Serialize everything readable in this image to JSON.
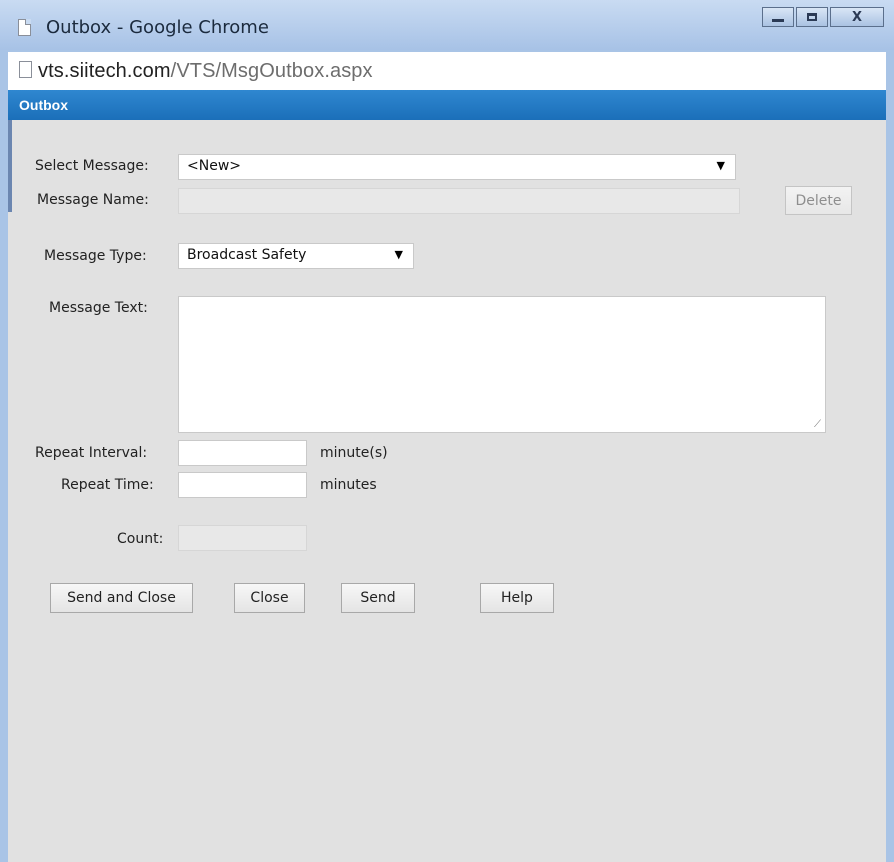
{
  "window": {
    "title": "Outbox - Google Chrome",
    "controls": {
      "minimize": "–",
      "maximize": "□",
      "close": "X"
    }
  },
  "address": {
    "domain": "vts.siitech.com",
    "path": "/VTS/MsgOutbox.aspx"
  },
  "page": {
    "header": "Outbox"
  },
  "form": {
    "select_message": {
      "label": "Select Message:",
      "value": "<New>"
    },
    "message_name": {
      "label": "Message Name:",
      "value": ""
    },
    "delete_label": "Delete",
    "message_type": {
      "label": "Message Type:",
      "value": "Broadcast Safety"
    },
    "message_text": {
      "label": "Message Text:",
      "value": ""
    },
    "repeat_interval": {
      "label": "Repeat Interval:",
      "value": "",
      "unit": "minute(s)"
    },
    "repeat_time": {
      "label": "Repeat Time:",
      "value": "",
      "unit": "minutes"
    },
    "count": {
      "label": "Count:",
      "value": ""
    }
  },
  "buttons": {
    "send_and_close": "Send and Close",
    "close": "Close",
    "send": "Send",
    "help": "Help"
  },
  "colors": {
    "titlebar": "#b7cfee",
    "header_bar": "#1f74bd",
    "content_bg": "#e1e1e1"
  }
}
